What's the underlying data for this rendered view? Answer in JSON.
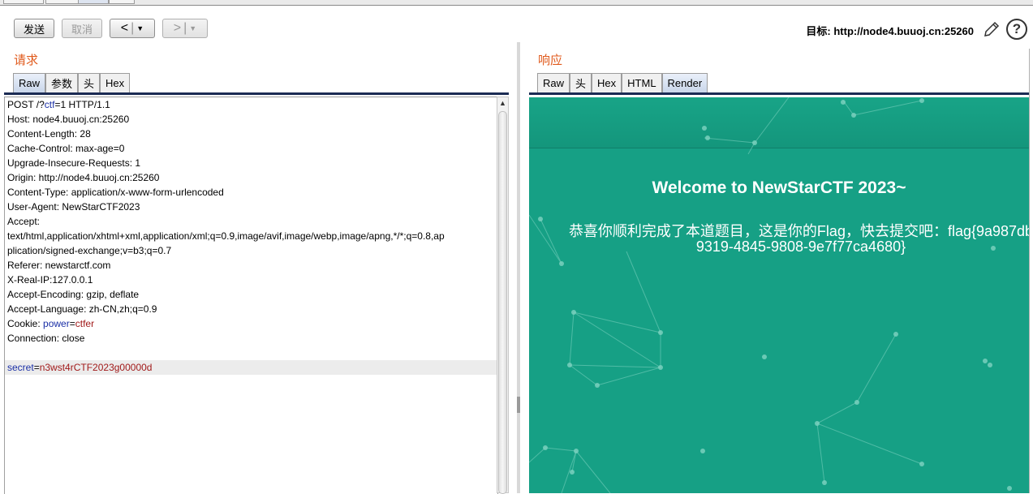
{
  "toolbar": {
    "send_label": "发送",
    "cancel_label": "取消",
    "back_glyph": "<",
    "forward_glyph": ">",
    "dropdown_glyph": "▼",
    "target_label": "目标: http://node4.buuoj.cn:25260"
  },
  "request": {
    "title": "请求",
    "tabs": [
      "Raw",
      "参数",
      "头",
      "Hex"
    ],
    "active_tab": "Raw",
    "lines": [
      [
        {
          "t": "POST /?"
        },
        {
          "t": "ctf",
          "c": "k"
        },
        {
          "t": "=1 HTTP/1.1"
        }
      ],
      [
        {
          "t": "Host: node4.buuoj.cn:25260"
        }
      ],
      [
        {
          "t": "Content-Length: 28"
        }
      ],
      [
        {
          "t": "Cache-Control: max-age=0"
        }
      ],
      [
        {
          "t": "Upgrade-Insecure-Requests: 1"
        }
      ],
      [
        {
          "t": "Origin: http://node4.buuoj.cn:25260"
        }
      ],
      [
        {
          "t": "Content-Type: application/x-www-form-urlencoded"
        }
      ],
      [
        {
          "t": "User-Agent: NewStarCTF2023"
        }
      ],
      [
        {
          "t": "Accept:"
        }
      ],
      [
        {
          "t": "text/html,application/xhtml+xml,application/xml;q=0.9,image/avif,image/webp,image/apng,*/*;q=0.8,ap"
        }
      ],
      [
        {
          "t": "plication/signed-exchange;v=b3;q=0.7"
        }
      ],
      [
        {
          "t": "Referer: newstarctf.com"
        }
      ],
      [
        {
          "t": "X-Real-IP:127.0.0.1"
        }
      ],
      [
        {
          "t": "Accept-Encoding: gzip, deflate"
        }
      ],
      [
        {
          "t": "Accept-Language: zh-CN,zh;q=0.9"
        }
      ],
      [
        {
          "t": "Cookie: "
        },
        {
          "t": "power",
          "c": "k"
        },
        {
          "t": "="
        },
        {
          "t": "ctfer",
          "c": "v"
        }
      ],
      [
        {
          "t": "Connection: close"
        }
      ],
      [
        {
          "t": ""
        }
      ],
      [
        {
          "t": "secret",
          "c": "k"
        },
        {
          "t": "="
        },
        {
          "t": "n3wst4rCTF2023g00000d",
          "c": "v"
        }
      ]
    ],
    "highlight_line": 18
  },
  "response": {
    "title": "响应",
    "tabs": [
      "Raw",
      "头",
      "Hex",
      "HTML",
      "Render"
    ],
    "active_tab": "Render",
    "welcome": "Welcome to NewStarCTF 2023~",
    "flag_text": "恭喜你顺利完成了本道题目，这是你的Flag，快去提交吧：flag{9a987db\n9319-4845-9808-9e7f77ca4680}"
  },
  "colors": {
    "section_title": "#e05a1c",
    "render_bg": "#16a085",
    "key_blue": "#1a2fa6",
    "value_red": "#a11a1a"
  },
  "icons": [
    "pencil-icon",
    "help-icon",
    "scroll-up-icon"
  ]
}
